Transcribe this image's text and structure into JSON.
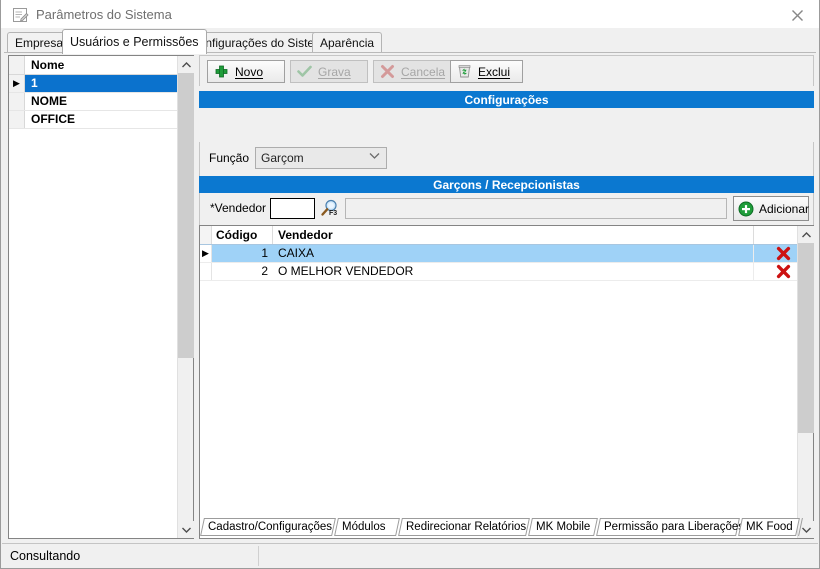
{
  "window": {
    "title": "Parâmetros do Sistema",
    "icon": "form-edit-icon",
    "close_label": "✕"
  },
  "top_tabs": [
    {
      "label": "Empresa",
      "active": false
    },
    {
      "label": "Usuários e Permissões",
      "active": true
    },
    {
      "label": "Configurações do Sistema",
      "active": false
    },
    {
      "label": "Aparência",
      "active": false
    }
  ],
  "left_grid": {
    "column_header": "Nome",
    "rows": [
      {
        "indicator": "▶",
        "name": "1",
        "selected": true
      },
      {
        "indicator": "",
        "name": "NOME",
        "selected": false
      },
      {
        "indicator": "",
        "name": "OFFICE",
        "selected": false
      }
    ]
  },
  "toolbar": {
    "novo_label": "Novo",
    "grava_label": "Grava",
    "cancela_label": "Cancela",
    "exclui_label": "Exclui"
  },
  "sections": {
    "configuracoes_title": "Configurações",
    "garcons_title": "Garçons / Recepcionistas"
  },
  "funcao": {
    "label": "Função",
    "value": "Garçom",
    "options": [
      "Garçom"
    ]
  },
  "vendedor_form": {
    "label": "*Vendedor",
    "code_value": "",
    "code_placeholder": "",
    "lookup_key": "F3",
    "name_value": "",
    "name_placeholder": "",
    "add_label": "Adicionar"
  },
  "vendor_grid": {
    "columns": [
      "Código",
      "Vendedor"
    ],
    "rows": [
      {
        "indicator": "▶",
        "codigo": "1",
        "vendedor": "CAIXA",
        "selected": true
      },
      {
        "indicator": "",
        "codigo": "2",
        "vendedor": "O MELHOR VENDEDOR",
        "selected": false
      }
    ]
  },
  "bottom_tabs": [
    "Cadastro/Configurações",
    "Módulos",
    "Redirecionar Relatórios",
    "MK Mobile",
    "Permissão para Liberações",
    "MK Food"
  ],
  "status": {
    "text": "Consultando"
  },
  "colors": {
    "accent_blue": "#0b78d0",
    "selection_blue": "#0b72cd",
    "grid_selection": "#9fd2f7",
    "green": "#1f9d3a",
    "red": "#cc1111"
  }
}
